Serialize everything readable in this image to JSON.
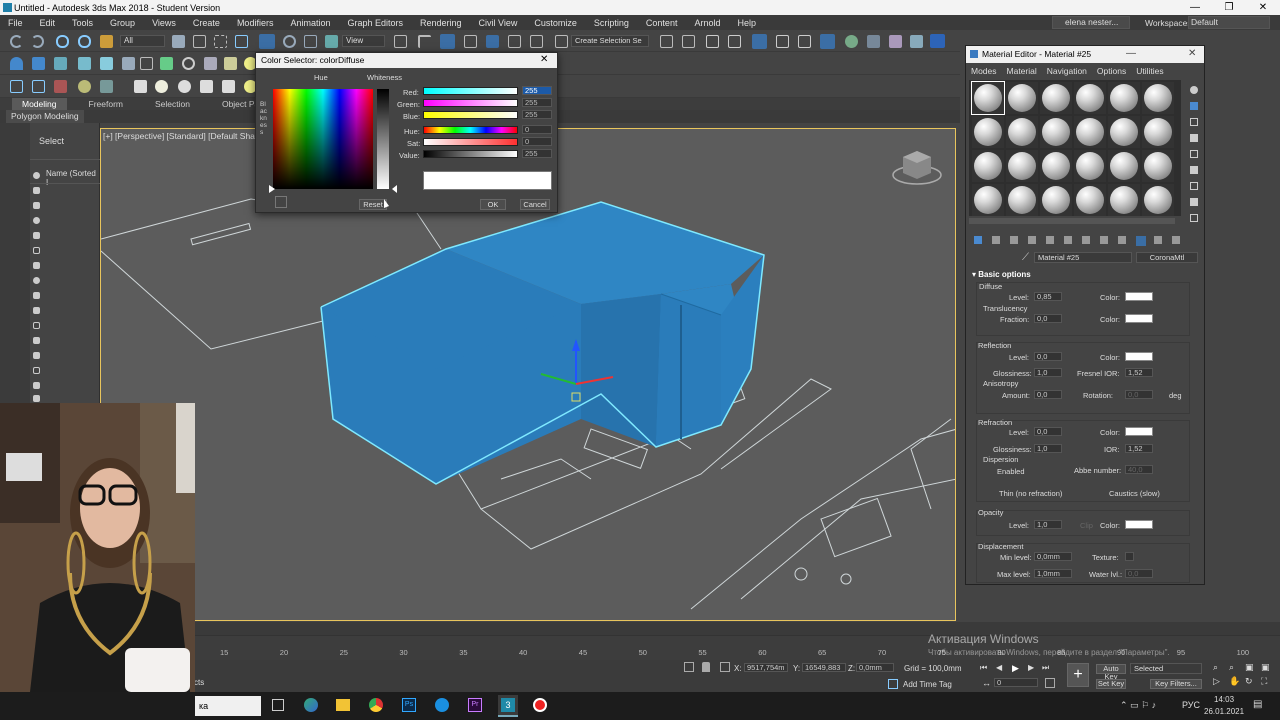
{
  "window": {
    "title": "Untitled - Autodesk 3ds Max 2018 - Student Version",
    "controls": [
      "—",
      "❐",
      "✕"
    ]
  },
  "menubar": {
    "items": [
      "File",
      "Edit",
      "Tools",
      "Group",
      "Views",
      "Create",
      "Modifiers",
      "Animation",
      "Graph Editors",
      "Rendering",
      "Civil View",
      "Customize",
      "Scripting",
      "Content",
      "Arnold",
      "Help"
    ],
    "user": "elena nester...",
    "workspaces_label": "Workspaces:",
    "workspaces_value": "Default"
  },
  "toolbar": {
    "selection_filter": "All",
    "ref_coord": "View",
    "named_selection": "Create Selection Se"
  },
  "ribbon": {
    "tabs": [
      "Modeling",
      "Freeform",
      "Selection",
      "Object Paint"
    ],
    "active": "Modeling",
    "sub_tab": "Polygon Modeling"
  },
  "scene_explorer": {
    "title": "Select",
    "column": "Name (Sorted I"
  },
  "viewport": {
    "label": "[+] [Perspective] [Standard] [Default Shadin"
  },
  "color_selector": {
    "title": "Color Selector: colorDiffuse",
    "hue_label": "Hue",
    "whiteness_label": "Whiteness",
    "blackness_label": "Blackness",
    "channels": [
      {
        "label": "Red:",
        "value": "255"
      },
      {
        "label": "Green:",
        "value": "255"
      },
      {
        "label": "Blue:",
        "value": "255"
      },
      {
        "label": "Hue:",
        "value": "0"
      },
      {
        "label": "Sat:",
        "value": "0"
      },
      {
        "label": "Value:",
        "value": "255"
      }
    ],
    "reset": "Reset",
    "ok": "OK",
    "cancel": "Cancel",
    "current_color": "#ffffff"
  },
  "material_editor": {
    "title": "Material Editor - Material #25",
    "menu": [
      "Modes",
      "Material",
      "Navigation",
      "Options",
      "Utilities"
    ],
    "material_name": "Material #25",
    "material_type": "CoronaMtl",
    "rollout": "Basic options",
    "diffuse": {
      "heading": "Diffuse",
      "level_label": "Level:",
      "level": "0,85",
      "color_label": "Color:"
    },
    "translucency": {
      "heading": "Translucency",
      "fraction_label": "Fraction:",
      "fraction": "0,0",
      "color_label": "Color:"
    },
    "reflection": {
      "heading": "Reflection",
      "level_label": "Level:",
      "level": "0,0",
      "color_label": "Color:",
      "gloss_label": "Glossiness:",
      "gloss": "1,0",
      "fresnel_label": "Fresnel IOR:",
      "fresnel": "1,52",
      "aniso_label": "Anisotropy",
      "amount_label": "Amount:",
      "amount": "0,0",
      "rotation_label": "Rotation:",
      "rotation": "0,0",
      "deg": "deg"
    },
    "refraction": {
      "heading": "Refraction",
      "level_label": "Level:",
      "level": "0,0",
      "color_label": "Color:",
      "gloss_label": "Glossiness:",
      "gloss": "1,0",
      "ior_label": "IOR:",
      "ior": "1,52",
      "dispersion_label": "Dispersion",
      "enabled_label": "Enabled",
      "abbe_label": "Abbe number:",
      "abbe": "40,0",
      "thin_label": "Thin (no refraction)",
      "caustics_label": "Caustics (slow)"
    },
    "opacity": {
      "heading": "Opacity",
      "level_label": "Level:",
      "level": "1,0",
      "clip_label": "Clip",
      "color_label": "Color:"
    },
    "displacement": {
      "heading": "Displacement",
      "min_label": "Min level:",
      "min": "0,0mm",
      "texture_label": "Texture:",
      "max_label": "Max level:",
      "max": "1,0mm",
      "water_label": "Water lvl.:",
      "water": "0,0"
    }
  },
  "timeline": {
    "ticks": [
      "15",
      "20",
      "25",
      "30",
      "35",
      "40",
      "45",
      "50",
      "55",
      "60",
      "65",
      "70",
      "75",
      "80",
      "85",
      "90",
      "95",
      "100"
    ]
  },
  "statusbar": {
    "x_label": "X:",
    "x": "9517,754m",
    "y_label": "Y:",
    "y": "16549,883",
    "z_label": "Z:",
    "z": "0,0mm",
    "grid": "Grid = 100,0mm",
    "add_time_tag": "Add Time Tag",
    "auto_key": "Auto Key",
    "set_key": "Set Key",
    "selected": "Selected",
    "key_filters": "Key Filters...",
    "frame": "0",
    "partial_left": "cts"
  },
  "watermark": {
    "line1": "Активация Windows",
    "line2": "Чтобы активировать Windows, перейдите в раздел \"Параметры\"."
  },
  "taskbar": {
    "lang": "РУС",
    "time": "14:03",
    "date": "26.01.2021",
    "search_partial": "ка"
  },
  "colors": {
    "building": "#2f86c4",
    "selection_outline": "#7fe9ff",
    "viewport_border": "#e8c55d"
  }
}
